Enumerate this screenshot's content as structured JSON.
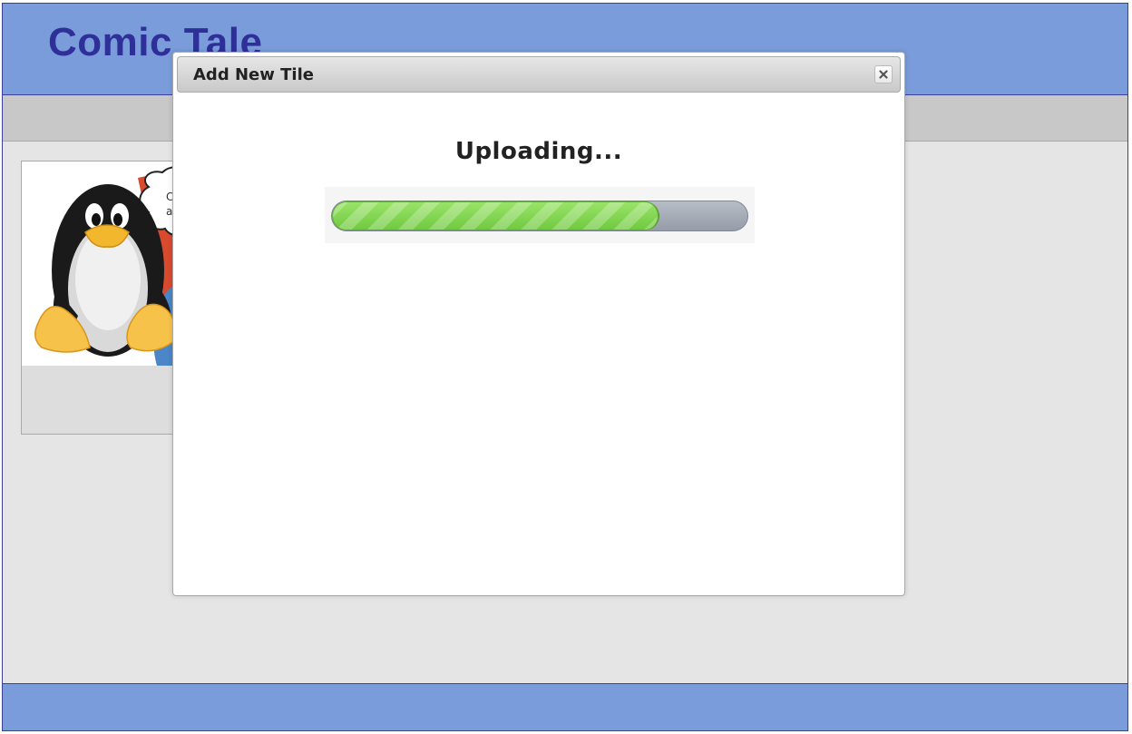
{
  "app": {
    "title": "Comic Tale"
  },
  "tile": {
    "image_subject": "penguin-with-speech-bubble",
    "bubble_text_partial": [
      "C",
      "a"
    ]
  },
  "modal": {
    "title": "Add New Tile",
    "close_icon": "close-icon",
    "status": "Uploading...",
    "progress_fraction": 0.785
  },
  "colors": {
    "header_bg": "#7a9cda",
    "title_color": "#2f2f9a",
    "toolbar_bg": "#c8c8c8",
    "page_bg": "#e5e5e5",
    "progress_fill": "#7dd64c",
    "progress_track": "#a4aab4"
  }
}
